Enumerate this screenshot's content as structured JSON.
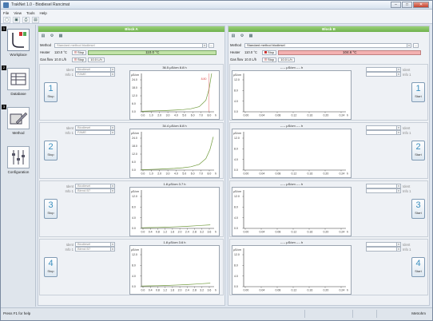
{
  "window": {
    "title": "TrakNet 1.0 - Biodiesel Rancimat",
    "min": "–",
    "max": "□",
    "close": "✕"
  },
  "menu": [
    "File",
    "View",
    "Tools",
    "Help"
  ],
  "sidebar": {
    "items": [
      {
        "label": "Workplace",
        "num": "1"
      },
      {
        "label": "Database",
        "num": "2"
      },
      {
        "label": "Method",
        "num": "3"
      },
      {
        "label": "Configuration",
        "num": ""
      }
    ]
  },
  "blocks": [
    {
      "title": "Block A",
      "method_label": "Method",
      "method_value": "Standard method biodiesel",
      "heater_label": "Heater",
      "heater_value": "110.0 °C",
      "heater_bar": "110.0 °C",
      "stop_label": "Stop",
      "gasflow_label": "Gas flow",
      "gasflow_value": "10.0 L/h",
      "gasflow_field": "10.0 L/h",
      "active": false,
      "channels": [
        {
          "num": "1",
          "action": "Stop",
          "ident_label": "Ident",
          "ident_value": "Biodiesel",
          "info_label": "Info 1",
          "info_value": "FAME",
          "plot_title": "36.5 µS/cm   8.8 h",
          "yunit": "µS/cm",
          "yticks": [
            "24.0",
            "18.0",
            "12.0",
            "6.0",
            "0.0"
          ],
          "xticks": [
            "0.0",
            "1.0",
            "2.0",
            "3.0",
            "4.0",
            "5.0",
            "6.0",
            "7.0",
            "8.0"
          ],
          "xunit": "h",
          "annot": "8.80"
        },
        {
          "num": "2",
          "action": "Stop",
          "ident_label": "Ident",
          "ident_value": "Biodiesel",
          "info_label": "Info 1",
          "info_value": "FAME",
          "plot_title": "34.4 µS/cm   8.8 h",
          "yunit": "µS/cm",
          "yticks": [
            "24.0",
            "18.0",
            "12.0",
            "6.0",
            "0.0"
          ],
          "xticks": [
            "0.0",
            "1.0",
            "2.0",
            "3.0",
            "4.0",
            "5.0",
            "6.0",
            "7.0",
            "8.0"
          ],
          "xunit": "h",
          "annot": ""
        },
        {
          "num": "3",
          "action": "Stop",
          "ident_label": "Ident",
          "ident_value": "Biodiesel",
          "info_label": "Info 1",
          "info_value": "Blend B7",
          "plot_title": "1.8 µS/cm   3.7 h",
          "yunit": "µS/cm",
          "yticks": [
            "12.0",
            "8.0",
            "4.0",
            "0.0"
          ],
          "xticks": [
            "0.0",
            "0.4",
            "0.8",
            "1.2",
            "1.6",
            "2.0",
            "2.4",
            "2.8",
            "3.2",
            "3.6"
          ],
          "xunit": "h",
          "annot": ""
        },
        {
          "num": "4",
          "action": "Stop",
          "ident_label": "Ident",
          "ident_value": "Biodiesel",
          "info_label": "Info 1",
          "info_value": "Blend B7",
          "plot_title": "1.8 µS/cm   3.6 h",
          "yunit": "µS/cm",
          "yticks": [
            "12.0",
            "8.0",
            "4.0",
            "0.0"
          ],
          "xticks": [
            "0.0",
            "0.4",
            "0.8",
            "1.2",
            "1.6",
            "2.0",
            "2.4",
            "2.8",
            "3.2",
            "3.6"
          ],
          "xunit": "h",
          "annot": ""
        }
      ]
    },
    {
      "title": "Block B",
      "method_label": "Method",
      "method_value": "Standard method biodiesel",
      "heater_label": "Heater",
      "heater_value": "110.0 °C",
      "heater_bar": "104.6 °C",
      "stop_label": "Stop",
      "gasflow_label": "Gas flow",
      "gasflow_value": "10.0 L/h",
      "gasflow_field": "10.0 L/h",
      "active": true,
      "channels": [
        {
          "num": "1",
          "action": "Start",
          "ident_label": "Ident",
          "ident_value": "",
          "info_label": "Info 1",
          "info_value": "",
          "plot_title": "--.-- µS/cm   --.- h",
          "yunit": "µS/cm",
          "yticks": [
            "12.0",
            "8.0",
            "4.0",
            "0.0"
          ],
          "xticks": [
            "0.00",
            "0.04",
            "0.08",
            "0.12",
            "0.16",
            "0.20",
            "0.24"
          ],
          "xunit": "h",
          "annot": ""
        },
        {
          "num": "2",
          "action": "Start",
          "ident_label": "Ident",
          "ident_value": "",
          "info_label": "Info 1",
          "info_value": "",
          "plot_title": "--.-- µS/cm   --.- h",
          "yunit": "µS/cm",
          "yticks": [
            "12.0",
            "8.0",
            "4.0",
            "0.0"
          ],
          "xticks": [
            "0.00",
            "0.04",
            "0.08",
            "0.12",
            "0.16",
            "0.20",
            "0.24"
          ],
          "xunit": "h",
          "annot": ""
        },
        {
          "num": "3",
          "action": "Start",
          "ident_label": "Ident",
          "ident_value": "",
          "info_label": "Info 1",
          "info_value": "",
          "plot_title": "--.-- µS/cm   --.- h",
          "yunit": "µS/cm",
          "yticks": [
            "12.0",
            "8.0",
            "4.0",
            "0.0"
          ],
          "xticks": [
            "0.00",
            "0.04",
            "0.08",
            "0.12",
            "0.16",
            "0.20",
            "0.24"
          ],
          "xunit": "h",
          "annot": ""
        },
        {
          "num": "4",
          "action": "Start",
          "ident_label": "Ident",
          "ident_value": "",
          "info_label": "Info 1",
          "info_value": "",
          "plot_title": "--.-- µS/cm   --.- h",
          "yunit": "µS/cm",
          "yticks": [
            "12.0",
            "8.0",
            "4.0",
            "0.0"
          ],
          "xticks": [
            "0.00",
            "0.04",
            "0.08",
            "0.12",
            "0.16",
            "0.20",
            "0.24"
          ],
          "xunit": "h",
          "annot": ""
        }
      ]
    }
  ],
  "status": {
    "left": "Press F1 for help",
    "right": "Metrohm"
  },
  "colors": {
    "green": "#6eb24c",
    "curve": "#6f9a3a",
    "accent_blue": "#3a8fbf",
    "red": "#cc3333"
  }
}
